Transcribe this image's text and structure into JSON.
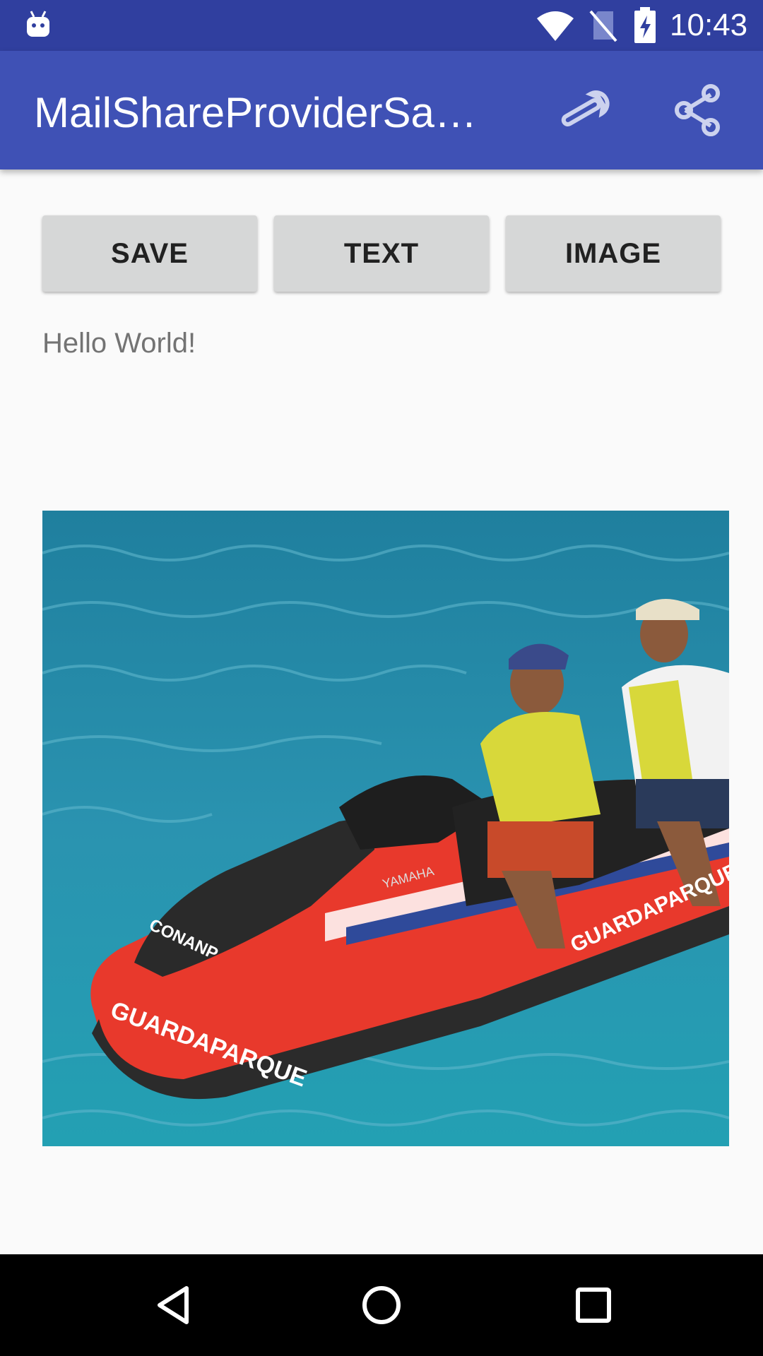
{
  "status_bar": {
    "time": "10:43",
    "icons": [
      "android-icon",
      "wifi-icon",
      "no-sim-icon",
      "battery-charging-icon"
    ]
  },
  "app_bar": {
    "title": "MailShareProviderSam…",
    "actions": [
      "wrench-icon",
      "share-icon"
    ]
  },
  "buttons": {
    "save_label": "SAVE",
    "text_label": "TEXT",
    "image_label": "IMAGE"
  },
  "content": {
    "hello_text": "Hello World!"
  },
  "image": {
    "description_icon": "photo-jet-ski",
    "hull_text": "GUARDAPARQUE",
    "decal_text": "CONANP",
    "brand_text": "YAMAHA"
  },
  "nav_bar": {
    "icons": [
      "back-icon",
      "home-icon",
      "recents-icon"
    ]
  },
  "colors": {
    "status_bar": "#303f9f",
    "app_bar": "#3f51b5",
    "button_bg": "#d6d7d7",
    "background": "#fafafa",
    "water": "#2a93b0",
    "hull": "#e8392c"
  }
}
